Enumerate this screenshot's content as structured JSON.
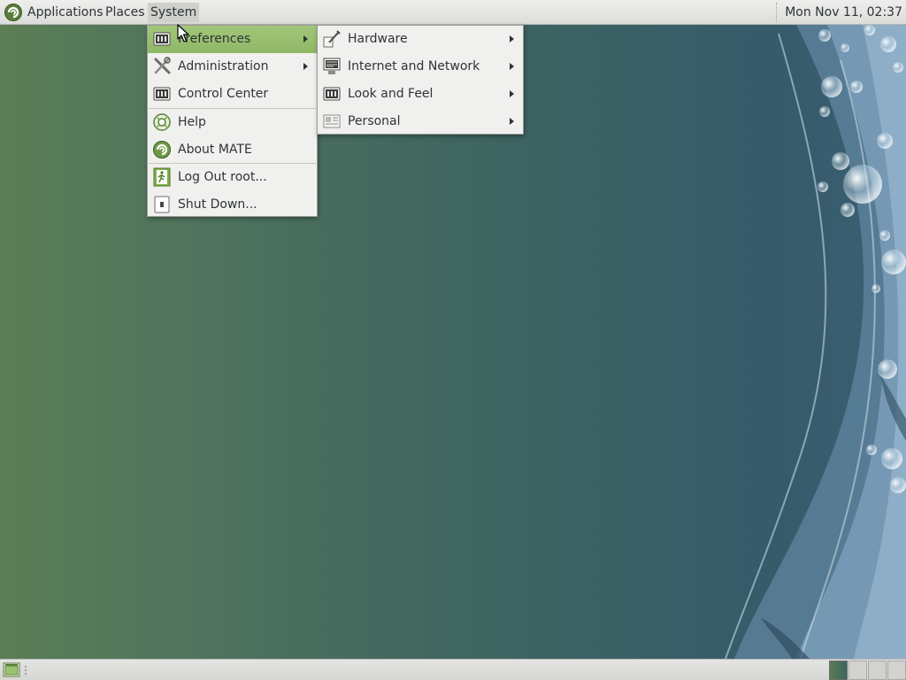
{
  "top_panel": {
    "menus": [
      {
        "label": "Applications"
      },
      {
        "label": "Places"
      },
      {
        "label": "System"
      }
    ],
    "clock": "Mon Nov 11, 02:37"
  },
  "system_menu": {
    "items": [
      {
        "label": "Preferences",
        "icon": "preferences-icon",
        "submenu": true,
        "highlighted": true
      },
      {
        "label": "Administration",
        "icon": "administration-icon",
        "submenu": true
      },
      {
        "label": "Control Center",
        "icon": "control-center-icon",
        "submenu": false
      },
      {
        "label": "Help",
        "icon": "help-icon",
        "submenu": false
      },
      {
        "label": "About MATE",
        "icon": "mate-logo-icon",
        "submenu": false
      },
      {
        "label": "Log Out root...",
        "icon": "logout-icon",
        "submenu": false
      },
      {
        "label": "Shut Down...",
        "icon": "shutdown-icon",
        "submenu": false
      }
    ]
  },
  "preferences_submenu": {
    "items": [
      {
        "label": "Hardware",
        "icon": "hardware-icon",
        "submenu": true
      },
      {
        "label": "Internet and Network",
        "icon": "network-icon",
        "submenu": true
      },
      {
        "label": "Look and Feel",
        "icon": "appearance-icon",
        "submenu": true
      },
      {
        "label": "Personal",
        "icon": "personal-icon",
        "submenu": true
      }
    ]
  },
  "bottom_panel": {
    "workspaces": [
      {
        "active": true
      },
      {
        "active": false
      },
      {
        "active": false
      },
      {
        "active": false
      }
    ]
  },
  "colors": {
    "menu_highlight": "#9bc171",
    "panel_bg": "#e6e6e4",
    "desktop_left": "#5b7e55",
    "desktop_right": "#365b6b"
  }
}
